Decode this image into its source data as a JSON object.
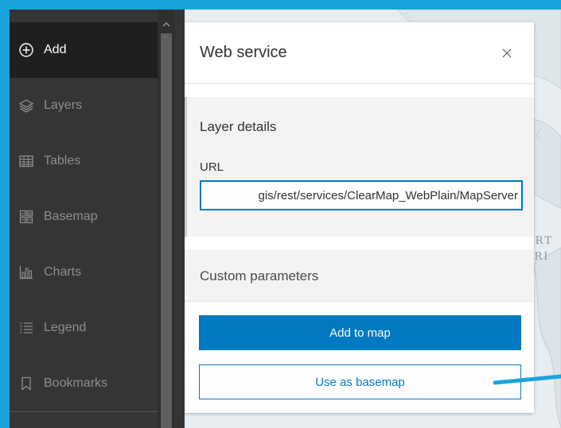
{
  "sidebar": {
    "items": [
      {
        "label": "Add",
        "icon": "plus-circle-icon",
        "active": true
      },
      {
        "label": "Layers",
        "icon": "layers-icon",
        "active": false
      },
      {
        "label": "Tables",
        "icon": "table-icon",
        "active": false
      },
      {
        "label": "Basemap",
        "icon": "basemap-icon",
        "active": false
      },
      {
        "label": "Charts",
        "icon": "bar-chart-icon",
        "active": false
      },
      {
        "label": "Legend",
        "icon": "legend-icon",
        "active": false
      },
      {
        "label": "Bookmarks",
        "icon": "bookmark-icon",
        "active": false
      }
    ]
  },
  "dialog": {
    "title": "Web service",
    "close_icon": "close-icon",
    "layer_details": {
      "title": "Layer details",
      "url_label": "URL",
      "url_value": "gis/rest/services/ClearMap_WebPlain/MapServer"
    },
    "custom_parameters": {
      "title": "Custom parameters"
    },
    "add_to_map_label": "Add to map",
    "use_as_basemap_label": "Use as basemap"
  },
  "map": {
    "labels": [
      "ORT",
      "ERI"
    ]
  },
  "colors": {
    "frame": "#1aa3dc",
    "accent": "#0079c1",
    "sidebar_bg": "#353535",
    "sidebar_active_bg": "#1f1f1f",
    "pointer": "#1aa3dc"
  }
}
